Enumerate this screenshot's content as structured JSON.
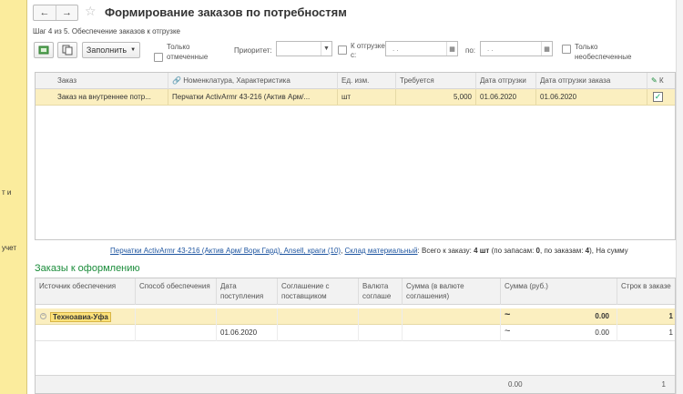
{
  "window": {
    "title": "Формирование заказов по потребностям"
  },
  "left_strip": {
    "line1": "т и",
    "line2": "учет"
  },
  "step": "Шаг 4 из 5. Обеспечение заказов к отгрузке",
  "toolbar": {
    "fill_label": "Заполнить",
    "only_marked_line1": "Только",
    "only_marked_line2": "отмеченные",
    "priority_label": "Приоритет:",
    "ship_from_line1": "К отгрузке",
    "ship_from_line2": "с:",
    "ship_from_value": ". .",
    "to_label": "по:",
    "to_value": ". .",
    "unsecured_line1": "Только",
    "unsecured_line2": "необеспеченные"
  },
  "orders_table": {
    "headers": [
      "Заказ",
      "Номенклатура, Характеристика",
      "Ед. изм.",
      "Требуется",
      "Дата отгрузки",
      "Дата отгрузки заказа",
      "К"
    ],
    "rows": [
      [
        "Заказ на внутреннее потр...",
        "Перчатки ActivArmr 43-216 (Актив Арм/...",
        "шт",
        "5,000",
        "01.06.2020",
        "01.06.2020"
      ]
    ]
  },
  "info": {
    "link1": "Перчатки ActivArmr 43-216 (Актив Арм/ Ворк Гард), Ansell, краги (10)",
    "sep": ", ",
    "link2": "Склад материальный",
    "text1": ": Всего к заказу: ",
    "total": "4 шт",
    "text2": " (по запасам: ",
    "stock": "0",
    "text3": ", по заказам: ",
    "orders": "4",
    "text4": "), На сумму"
  },
  "section_title": "Заказы к оформлению",
  "orders_to_issue": {
    "headers": [
      "Источник обеспечения",
      "Способ обеспечения",
      "Дата поступления",
      "Соглашение с поставщиком",
      "Валюта соглаше",
      "Сумма (в валюте соглашения)",
      "Сумма (руб.)",
      "Строк в заказе"
    ],
    "group_row": {
      "source": "Техноавиа-Уфа",
      "sum_rub": "0.00",
      "lines": "1"
    },
    "detail_row": {
      "date": "01.06.2020",
      "sum_rub": "0.00",
      "lines": "1"
    },
    "footer": {
      "sum_rub": "0.00",
      "lines": "1"
    },
    "approx": "~"
  }
}
